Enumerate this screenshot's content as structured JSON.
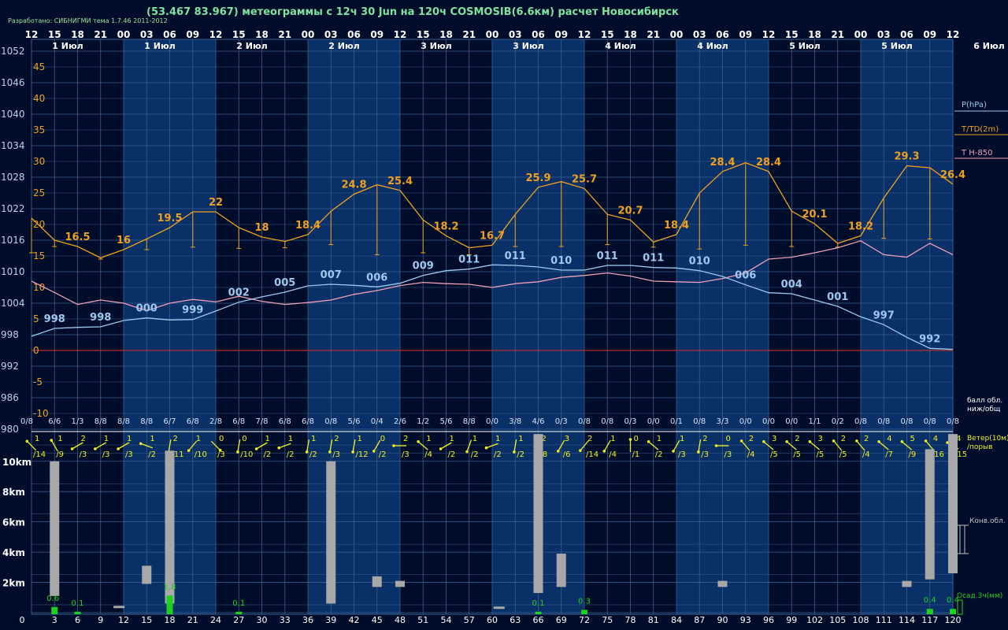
{
  "header": {
    "title": "(53.467 83.967) метеограммы с  12ч 30 Jun на 120ч COSMOSIB(6.6км) расчет Новосибирск",
    "developer": "Разработано: СИБНИГМИ тема 1.7.46 2011-2012"
  },
  "colors": {
    "background": "#000d2a",
    "band_light": "#0a3068",
    "grid": "#3a5e8c",
    "temperature": "#f0a020",
    "pressure": "#9fc8f0",
    "t850": "#f0a0b8",
    "wind": "#f0f020",
    "cloud_bar": "#a8a8a8",
    "precip": "#20d020"
  },
  "chart_data": {
    "type": "line",
    "hours_top": [
      "12",
      "15",
      "18",
      "21",
      "00",
      "03",
      "06",
      "09",
      "12",
      "15",
      "18",
      "21",
      "00",
      "03",
      "06",
      "09",
      "12",
      "15",
      "18",
      "21",
      "00",
      "03",
      "06",
      "09",
      "12",
      "15",
      "18",
      "21",
      "00",
      "03",
      "06",
      "09",
      "12",
      "15",
      "18",
      "21",
      "00",
      "03",
      "06",
      "09",
      "12"
    ],
    "day_labels": [
      "1 Июл",
      "1 Июл",
      "2 Июл",
      "2 Июл",
      "3 Июл",
      "3 Июл",
      "4 Июл",
      "4 Июл",
      "5 Июл",
      "5 Июл",
      "6 Июл"
    ],
    "forecast_hours": [
      "0",
      "3",
      "6",
      "9",
      "12",
      "15",
      "18",
      "21",
      "24",
      "27",
      "30",
      "33",
      "36",
      "39",
      "42",
      "45",
      "48",
      "51",
      "54",
      "57",
      "60",
      "63",
      "66",
      "69",
      "72",
      "75",
      "78",
      "81",
      "84",
      "87",
      "90",
      "93",
      "96",
      "99",
      "102",
      "105",
      "108",
      "111",
      "114",
      "117",
      "120"
    ],
    "pressure_ticks": [
      "1052",
      "1046",
      "1040",
      "1034",
      "1028",
      "1022",
      "1016",
      "1010",
      "1004",
      "998",
      "992",
      "986",
      "980"
    ],
    "temp_ticks": [
      "45",
      "40",
      "35",
      "30",
      "25",
      "20",
      "15",
      "10",
      "5",
      "0",
      "-5",
      "-10"
    ],
    "height_ticks": [
      "10km",
      "8km",
      "6km",
      "4km",
      "2km"
    ],
    "legend": {
      "pressure": "P(hPa)",
      "temperature": "T/TD(2m)",
      "t850": "T H-850",
      "cloud": "балл обл.\nниж/общ",
      "wind": "Ветер(10м)\n/порыв",
      "convective": "Конв.обл.",
      "precip": "Осад.3ч(мм)"
    },
    "temperature": [
      21,
      17.5,
      16.5,
      14.7,
      16,
      17.7,
      19.5,
      22,
      22,
      19.5,
      18,
      17.3,
      18.4,
      22.1,
      24.8,
      26.3,
      25.4,
      20.7,
      18.2,
      16.3,
      16.7,
      21.6,
      25.9,
      26.8,
      25.7,
      21.6,
      20.7,
      17.2,
      18.4,
      25,
      28.4,
      29.8,
      28.4,
      22.1,
      20.1,
      17,
      18.2,
      24.2,
      29.3,
      29,
      26.4
    ],
    "temperature_labels": [
      {
        "i": 2,
        "v": "16.5"
      },
      {
        "i": 4,
        "v": "16"
      },
      {
        "i": 6,
        "v": "19.5"
      },
      {
        "i": 8,
        "v": "22"
      },
      {
        "i": 10,
        "v": "18"
      },
      {
        "i": 12,
        "v": "18.4"
      },
      {
        "i": 14,
        "v": "24.8"
      },
      {
        "i": 16,
        "v": "25.4"
      },
      {
        "i": 18,
        "v": "18.2"
      },
      {
        "i": 20,
        "v": "16.7"
      },
      {
        "i": 22,
        "v": "25.9"
      },
      {
        "i": 24,
        "v": "25.7"
      },
      {
        "i": 26,
        "v": "20.7"
      },
      {
        "i": 28,
        "v": "18.4"
      },
      {
        "i": 30,
        "v": "28.4"
      },
      {
        "i": 32,
        "v": "28.4"
      },
      {
        "i": 34,
        "v": "20.1"
      },
      {
        "i": 36,
        "v": "18.2"
      },
      {
        "i": 38,
        "v": "29.3"
      },
      {
        "i": 40,
        "v": "26.4"
      }
    ],
    "dewpoint": [
      15.5,
      16.5,
      15.5,
      14.5,
      15.5,
      16,
      16.2,
      16.4,
      16.4,
      16.2,
      16.5,
      16.3,
      16.7,
      16.8,
      15,
      15.2,
      15,
      15.5,
      16,
      15.2,
      16.5,
      16.5,
      16.7,
      16.5,
      16.8,
      16.8,
      16.8,
      16.4,
      16.5,
      16.1,
      16.5,
      16.7,
      16.8,
      16.5,
      16.5,
      16.4,
      16.8,
      17.8,
      17.5,
      17.7,
      15.2
    ],
    "pressure": [
      997.7,
      999.2,
      999.4,
      999.5,
      1000.7,
      1001.2,
      1000.8,
      1000.9,
      1002.5,
      1004.2,
      1005.2,
      1006.1,
      1007.3,
      1007.6,
      1007.4,
      1007.1,
      1007.8,
      1009.3,
      1010.2,
      1010.5,
      1011.3,
      1011.2,
      1010.9,
      1010.3,
      1010.3,
      1011.2,
      1011.2,
      1010.8,
      1010.7,
      1010.2,
      1009.1,
      1007.5,
      1006,
      1005.8,
      1004.6,
      1003.4,
      1001.4,
      999.9,
      997.5,
      995.4,
      995.2
    ],
    "pressure_labels": [
      {
        "i": 1,
        "v": "998"
      },
      {
        "i": 3,
        "v": "998"
      },
      {
        "i": 5,
        "v": "000"
      },
      {
        "i": 7,
        "v": "999"
      },
      {
        "i": 9,
        "v": "002"
      },
      {
        "i": 11,
        "v": "005"
      },
      {
        "i": 13,
        "v": "007"
      },
      {
        "i": 15,
        "v": "006"
      },
      {
        "i": 17,
        "v": "009"
      },
      {
        "i": 19,
        "v": "011"
      },
      {
        "i": 21,
        "v": "011"
      },
      {
        "i": 23,
        "v": "010"
      },
      {
        "i": 25,
        "v": "011"
      },
      {
        "i": 27,
        "v": "011"
      },
      {
        "i": 29,
        "v": "010"
      },
      {
        "i": 31,
        "v": "006"
      },
      {
        "i": 33,
        "v": "004"
      },
      {
        "i": 35,
        "v": "001"
      },
      {
        "i": 37,
        "v": "997"
      },
      {
        "i": 39,
        "v": "992"
      }
    ],
    "t850": [
      11,
      9.2,
      7.3,
      8,
      7.5,
      6.3,
      7.5,
      8.1,
      7.7,
      8.6,
      7.8,
      7.3,
      7.6,
      8,
      8.9,
      9.5,
      10.3,
      10.8,
      10.6,
      10.5,
      10,
      10.6,
      10.9,
      11.6,
      11.9,
      12.3,
      11.8,
      11,
      10.9,
      10.8,
      11.4,
      12.3,
      14.5,
      14.8,
      15.5,
      16.3,
      17.4,
      15.2,
      14.8,
      17,
      15.2
    ],
    "cloud_cover": [
      "0/8",
      "6/6",
      "1/3",
      "8/8",
      "8/8",
      "8/8",
      "6/7",
      "6/8",
      "2/8",
      "6/8",
      "7/8",
      "6/8",
      "6/8",
      "0/8",
      "5/6",
      "0/4",
      "2/6",
      "1/2",
      "5/6",
      "8/8",
      "0/0",
      "3/8",
      "4/6",
      "0/3",
      "0/8",
      "0/8",
      "0/3",
      "0/0",
      "0/1",
      "0/8",
      "3/3",
      "0/0",
      "0/0",
      "0/0",
      "1/1",
      "0/2",
      "0/8",
      "0/8",
      "0/8",
      "0/8",
      "0/8"
    ],
    "wind_speed": [
      "1",
      "1",
      "2",
      "1",
      "1",
      "1",
      "2",
      "1",
      "0",
      "0",
      "1",
      "1",
      "1",
      "2",
      "1",
      "0",
      "2",
      "1",
      "1",
      "1",
      "1",
      "1",
      "2",
      "3",
      "2",
      "1",
      "0",
      "1",
      "1",
      "2",
      "0",
      "2",
      "3",
      "2",
      "3",
      "2",
      "2",
      "4",
      "5",
      "4",
      "4"
    ],
    "wind_gust": [
      "/14",
      "/9",
      "/3",
      "/3",
      "/3",
      "/2",
      "/11",
      "/10",
      "/3",
      "/10",
      "/2",
      "/2",
      "/2",
      "/3",
      "/12",
      "/2",
      "/3",
      "/4",
      "/2",
      "/2",
      "/2",
      "/2",
      "/8",
      "/6",
      "/14",
      "/4",
      "/1",
      "/2",
      "/3",
      "/3",
      "/3",
      "/4",
      "/5",
      "/5",
      "/5",
      "/5",
      "/4",
      "/7",
      "/9",
      "/16",
      "/15"
    ],
    "wind_dir_deg": [
      225,
      240,
      150,
      150,
      150,
      200,
      100,
      130,
      45,
      100,
      150,
      160,
      100,
      100,
      100,
      120,
      180,
      220,
      150,
      110,
      160,
      100,
      100,
      120,
      130,
      120,
      270,
      220,
      120,
      100,
      180,
      230,
      220,
      220,
      220,
      230,
      230,
      220,
      220,
      230,
      210
    ],
    "clouds": [
      {
        "i": 1,
        "lo": 1.1,
        "hi": 10.0
      },
      {
        "i": 6,
        "lo": 0.6,
        "hi": 10.7
      },
      {
        "i": 13,
        "lo": 0.6,
        "hi": 10.0
      },
      {
        "i": 5,
        "lo": 1.9,
        "hi": 3.1
      },
      {
        "i": 15,
        "lo": 1.7,
        "hi": 2.4
      },
      {
        "i": 16,
        "lo": 1.7,
        "hi": 2.1
      },
      {
        "i": 22,
        "lo": 1.3,
        "hi": 11.8
      },
      {
        "i": 23,
        "lo": 1.7,
        "hi": 3.9
      },
      {
        "i": 30,
        "lo": 1.7,
        "hi": 2.1
      },
      {
        "i": 38,
        "lo": 1.7,
        "hi": 2.1
      },
      {
        "i": 39,
        "lo": 2.2,
        "hi": 10.8
      },
      {
        "i": 40,
        "lo": 2.6,
        "hi": 11.8
      }
    ],
    "cloud_ticks": [
      {
        "i": 3.8,
        "h": 0.35
      },
      {
        "i": 20.3,
        "h": 0.3
      }
    ],
    "precip": [
      {
        "i": 1,
        "v": 0.6,
        "label": "0.6"
      },
      {
        "i": 2,
        "v": 0.1,
        "label": "0.1"
      },
      {
        "i": 6,
        "v": 1.8,
        "label": "1.8"
      },
      {
        "i": 9,
        "v": 0.1,
        "label": "0.1"
      },
      {
        "i": 22,
        "v": 0.1,
        "label": "0.1"
      },
      {
        "i": 24,
        "v": 0.3,
        "label": "0.3"
      },
      {
        "i": 39,
        "v": 0.4,
        "label": "0.4"
      },
      {
        "i": 40,
        "v": 0.4,
        "label": "0.4"
      }
    ],
    "pressure_range": [
      980,
      1052
    ],
    "temp_range": [
      -12.5,
      47.5
    ],
    "height_range": [
      0,
      11.6
    ],
    "grid": true
  }
}
